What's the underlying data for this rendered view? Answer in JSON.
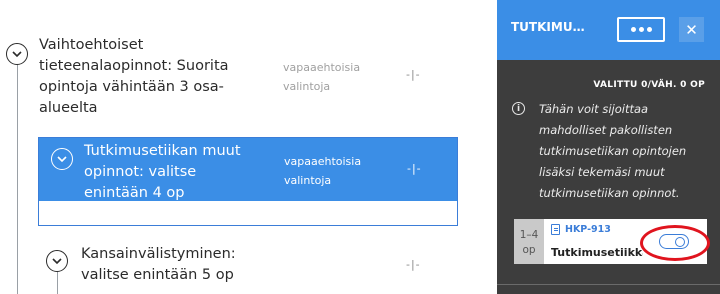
{
  "tree": {
    "group": {
      "title_lines": [
        "Vaihtoehtoiset",
        "tieteenalaopinnot: Suorita",
        "opintoja vähintään 3 osa-",
        "alueelta"
      ],
      "tag_lines": [
        "vapaaehtoisia",
        "valintoja"
      ],
      "credits": "-|-"
    },
    "selected": {
      "title_lines": [
        "Tutkimusetiikan muut",
        "opinnot: valitse",
        "enintään 4 op"
      ],
      "tag_lines": [
        "vapaaehtoisia",
        "valintoja"
      ],
      "credits": "-|-"
    },
    "next": {
      "title_lines": [
        "Kansainvälistyminen:",
        "valitse enintään 5 op"
      ],
      "credits": "-|-"
    }
  },
  "panel": {
    "title": "TUTKIMUSETII...",
    "menu_icon": "more-dots-icon",
    "close_icon": "close-icon",
    "close_label": "✕",
    "selected_count": "VALITTU 0/VÄH. 0 OP",
    "info_icon": "info-icon",
    "info_glyph": "i",
    "info_text": "Tähän voit sijoittaa mahdolliset pakollisten tutkimusetiikan opintojen lisäksi tekemäsi muut tutkimusetiikan opinnot.",
    "course": {
      "credits_range": "1–4",
      "credits_unit": "op",
      "code": "HKP-913",
      "name": "Tutkimusetiikka",
      "toggle_state": "off"
    }
  },
  "colors": {
    "accent": "#3b8ee6",
    "panel_bg": "#3d3d3d",
    "highlight_ring": "#e0141e"
  }
}
